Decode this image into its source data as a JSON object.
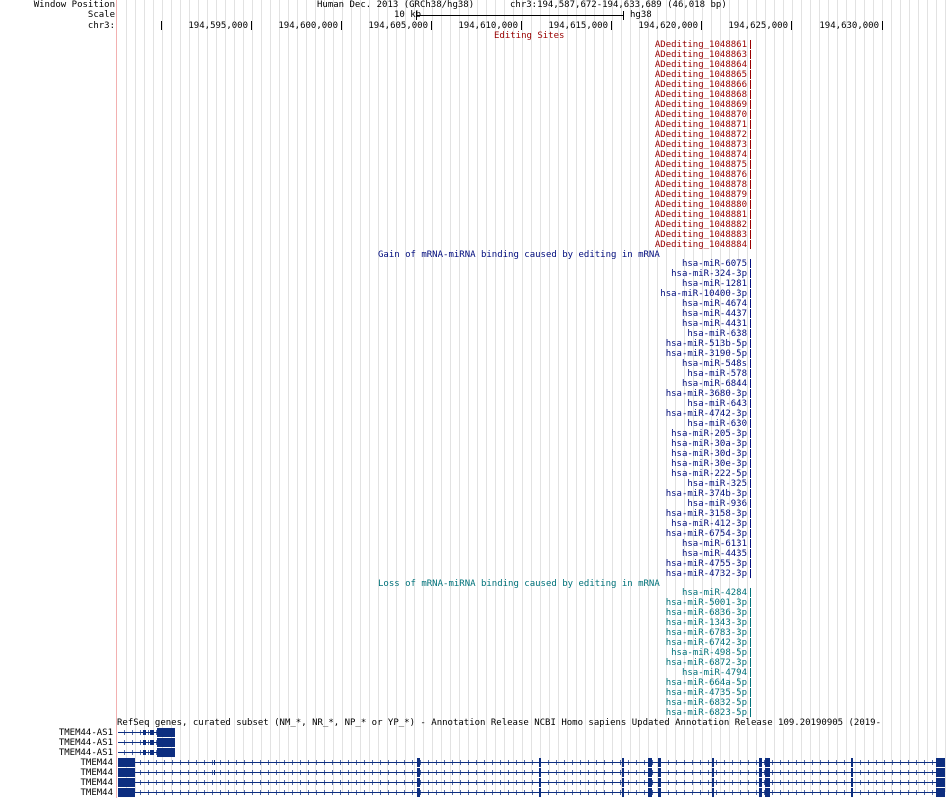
{
  "header": {
    "window_position_label": "Window Position",
    "scale_label": "Scale",
    "chrom_label": "chr3:",
    "assembly": "Human Dec. 2013 (GRCh38/hg38)",
    "position": "chr3:194,587,672-194,633,689 (46,018 bp)",
    "scale_text": "10 kb",
    "scale_db": "hg38"
  },
  "ruler_ticks": [
    "194,595,000",
    "194,600,000",
    "194,605,000",
    "194,610,000",
    "194,615,000",
    "194,620,000",
    "194,625,000",
    "194,630,000"
  ],
  "tracks": {
    "editing": {
      "title": "Editing Sites",
      "color": "#990000",
      "items": [
        "ADediting_1048861",
        "ADediting_1048863",
        "ADediting_1048864",
        "ADediting_1048865",
        "ADediting_1048866",
        "ADediting_1048868",
        "ADediting_1048869",
        "ADediting_1048870",
        "ADediting_1048871",
        "ADediting_1048872",
        "ADediting_1048873",
        "ADediting_1048874",
        "ADediting_1048875",
        "ADediting_1048876",
        "ADediting_1048878",
        "ADediting_1048879",
        "ADediting_1048880",
        "ADediting_1048881",
        "ADediting_1048882",
        "ADediting_1048883",
        "ADediting_1048884"
      ]
    },
    "gain": {
      "title": "Gain of mRNA-miRNA binding caused by editing in mRNA",
      "color": "#000c7d",
      "items": [
        "hsa-miR-6075",
        "hsa-miR-324-3p",
        "hsa-miR-1281",
        "hsa-miR-10400-3p",
        "hsa-miR-4674",
        "hsa-miR-4437",
        "hsa-miR-4431",
        "hsa-miR-638",
        "hsa-miR-513b-5p",
        "hsa-miR-3190-5p",
        "hsa-miR-548s",
        "hsa-miR-578",
        "hsa-miR-6844",
        "hsa-miR-3680-3p",
        "hsa-miR-643",
        "hsa-miR-4742-3p",
        "hsa-miR-630",
        "hsa-miR-205-3p",
        "hsa-miR-30a-3p",
        "hsa-miR-30d-3p",
        "hsa-miR-30e-3p",
        "hsa-miR-222-5p",
        "hsa-miR-325",
        "hsa-miR-374b-3p",
        "hsa-miR-936",
        "hsa-miR-3158-3p",
        "hsa-miR-412-3p",
        "hsa-miR-6754-3p",
        "hsa-miR-6131",
        "hsa-miR-4435",
        "hsa-miR-4755-3p",
        "hsa-miR-4732-3p"
      ]
    },
    "loss": {
      "title": "Loss of mRNA-miRNA binding caused by editing in mRNA",
      "color": "#00727a",
      "items": [
        "hsa-miR-4284",
        "hsa-miR-5001-3p",
        "hsa-miR-6836-3p",
        "hsa-miR-1343-3p",
        "hsa-miR-6783-3p",
        "hsa-miR-6742-3p",
        "hsa-miR-498-5p",
        "hsa-miR-6872-3p",
        "hsa-miR-4794",
        "hsa-miR-664a-5p",
        "hsa-miR-4735-5p",
        "hsa-miR-6832-5p",
        "hsa-miR-6823-5p"
      ]
    },
    "refseq": {
      "title": "RefSeq genes, curated subset (NM_*, NR_*, NP_* or YP_*) - Annotation Release NCBI Homo sapiens Updated Annotation Release 109.20190905 (2019-",
      "color": "#0d2e80",
      "genes": [
        "TMEM44-AS1",
        "TMEM44-AS1",
        "TMEM44-AS1",
        "TMEM44",
        "TMEM44",
        "TMEM44",
        "TMEM44"
      ]
    }
  }
}
